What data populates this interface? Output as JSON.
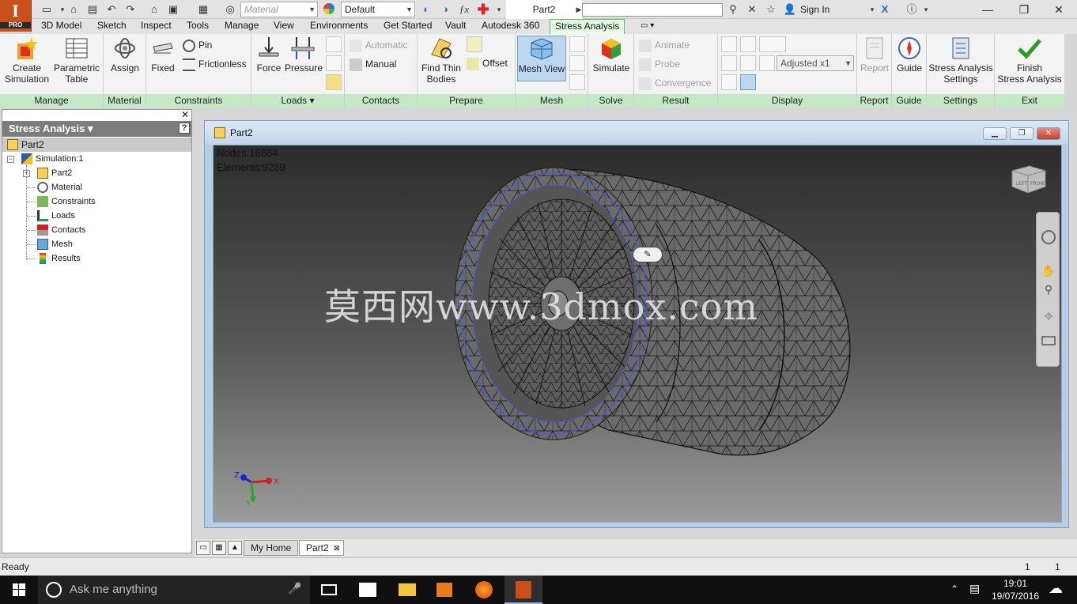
{
  "app": {
    "logo_text": "I",
    "logo_sub": "PRO",
    "document_title": "Part2",
    "sign_in": "Sign In",
    "material_combo": "Material",
    "appearance_combo": "Default"
  },
  "menu_tabs": [
    "3D Model",
    "Sketch",
    "Inspect",
    "Tools",
    "Manage",
    "View",
    "Environments",
    "Get Started",
    "Vault",
    "Autodesk 360",
    "Stress Analysis"
  ],
  "ribbon": {
    "manage": {
      "title": "Manage",
      "create_simulation": "Create\nSimulation",
      "parametric_table": "Parametric\nTable"
    },
    "material": {
      "title": "Material",
      "assign": "Assign"
    },
    "constraints": {
      "title": "Constraints",
      "fixed": "Fixed",
      "pin": "Pin",
      "frictionless": "Frictionless"
    },
    "loads": {
      "title": "Loads ▾",
      "force": "Force",
      "pressure": "Pressure"
    },
    "contacts": {
      "title": "Contacts",
      "automatic": "Automatic",
      "manual": "Manual"
    },
    "prepare": {
      "title": "Prepare",
      "find_thin_bodies": "Find Thin\nBodies",
      "offset": "Offset"
    },
    "mesh": {
      "title": "Mesh",
      "mesh_view": "Mesh View"
    },
    "solve": {
      "title": "Solve",
      "simulate": "Simulate"
    },
    "result": {
      "title": "Result",
      "animate": "Animate",
      "probe": "Probe",
      "convergence": "Convergence"
    },
    "display": {
      "title": "Display",
      "adjusted": "Adjusted x1"
    },
    "report": {
      "title": "Report",
      "report": "Report"
    },
    "guide": {
      "title": "Guide",
      "guide": "Guide"
    },
    "settings": {
      "title": "Settings",
      "stress_analysis_settings": "Stress Analysis\nSettings"
    },
    "exit": {
      "title": "Exit",
      "finish": "Finish\nStress Analysis"
    }
  },
  "browser": {
    "header": "Stress Analysis ▾",
    "root": "Part2",
    "items": [
      {
        "label": "Simulation:1"
      },
      {
        "label": "Part2"
      },
      {
        "label": "Material"
      },
      {
        "label": "Constraints"
      },
      {
        "label": "Loads"
      },
      {
        "label": "Contacts"
      },
      {
        "label": "Mesh"
      },
      {
        "label": "Results"
      }
    ]
  },
  "viewport": {
    "window_title": "Part2",
    "nodes": "Nodes:16664",
    "elements": "Elements:9289",
    "watermark": "莫西网www.3dmox.com",
    "axis_x": "X",
    "axis_y": "Y",
    "axis_z": "Z",
    "viewcube_left": "LEFT",
    "viewcube_front": "FRONT"
  },
  "doc_tabs": {
    "home": "My Home",
    "part": "Part2"
  },
  "status": {
    "text": "Ready",
    "count1": "1",
    "count2": "1"
  },
  "taskbar": {
    "search_placeholder": "Ask me anything",
    "time": "19:01",
    "date": "19/07/2016"
  },
  "colors": {
    "ribbon_active": "#e5ffe5",
    "panel_title": "#c6e8c6",
    "mesh_edge": "#4a5ad0",
    "logo": "#c8501a"
  }
}
